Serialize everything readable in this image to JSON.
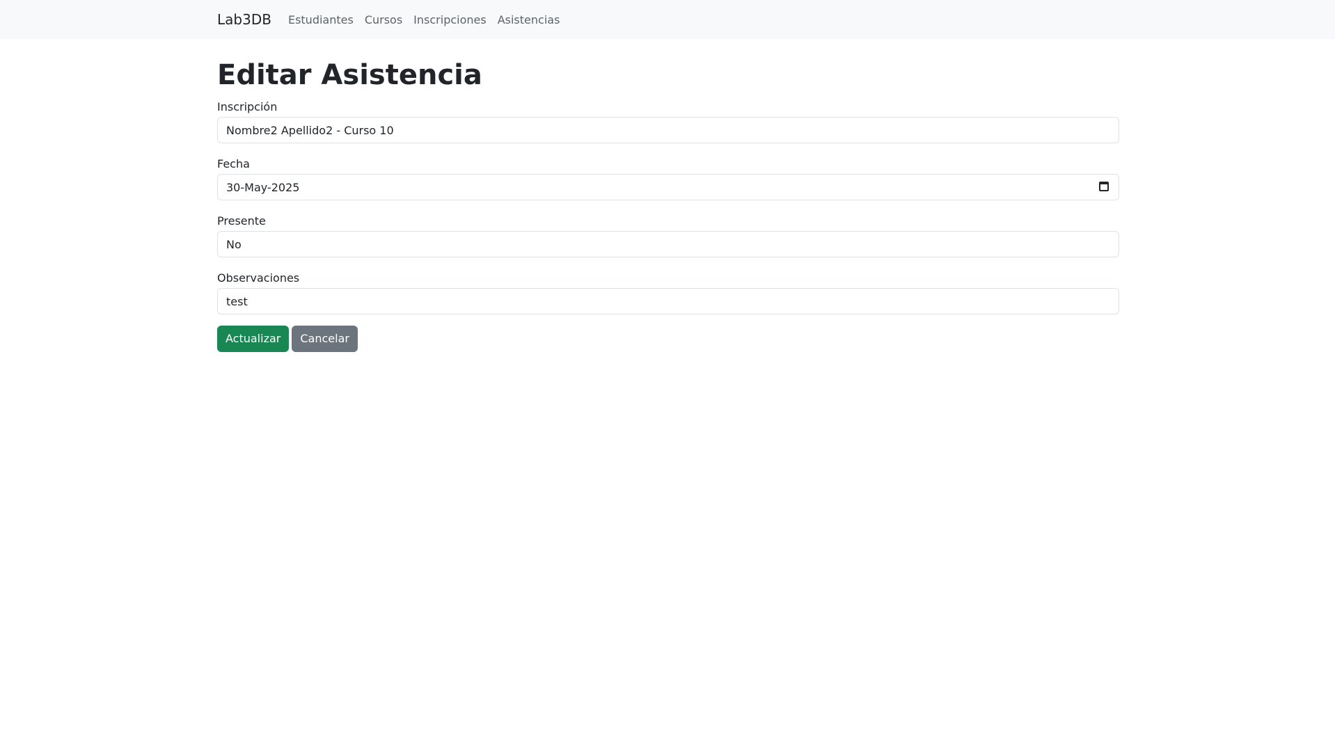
{
  "navbar": {
    "brand": "Lab3DB",
    "links": [
      "Estudiantes",
      "Cursos",
      "Inscripciones",
      "Asistencias"
    ]
  },
  "page": {
    "title": "Editar Asistencia"
  },
  "form": {
    "inscripcion": {
      "label": "Inscripción",
      "value": "Nombre2 Apellido2 - Curso 10"
    },
    "fecha": {
      "label": "Fecha",
      "value": "30-May-2025"
    },
    "presente": {
      "label": "Presente",
      "value": "No"
    },
    "observaciones": {
      "label": "Observaciones",
      "value": "test"
    }
  },
  "buttons": {
    "update": "Actualizar",
    "cancel": "Cancelar"
  },
  "colors": {
    "navbar_bg": "#f8f9fa",
    "success": "#198754",
    "secondary": "#6c757d"
  },
  "icons": {
    "date": "calendar-icon"
  }
}
